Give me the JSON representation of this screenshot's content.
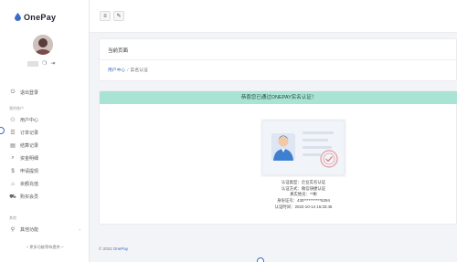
{
  "app": {
    "logo_text": "OnePay"
  },
  "sidebar": {
    "section1": "我的",
    "items": [
      {
        "label": "退出登录",
        "icon": "logout-icon",
        "glyph": "⏻"
      },
      {
        "label": "用户中心",
        "icon": "user-icon",
        "glyph": "⚇"
      },
      {
        "label": "订单记录",
        "icon": "list-icon",
        "glyph": "☰"
      },
      {
        "label": "结算记录",
        "icon": "record-icon",
        "glyph": "▤"
      },
      {
        "label": "资金明细",
        "icon": "search-money-icon",
        "glyph": "⌕"
      },
      {
        "label": "申请提现",
        "icon": "dollar-icon",
        "glyph": "$"
      },
      {
        "label": "余额充值",
        "icon": "bank-icon",
        "glyph": "⌂"
      },
      {
        "label": "购买会员",
        "icon": "cart-icon",
        "glyph": "⛟"
      }
    ],
    "section_label_1": "我的账户",
    "section_label_2": "其他",
    "other_item": {
      "label": "其他功能",
      "icon": "link-icon",
      "glyph": "⚲"
    },
    "more_note": "~ 更多功能等待提供 ~"
  },
  "topbar": {
    "menu_icon": "≡",
    "brush_icon": "✎"
  },
  "breadcrumb": {
    "title": "当前页面",
    "parent": "用户中心",
    "separator": "/",
    "current": "实名认证"
  },
  "verify": {
    "banner": "恭喜您已通过ONEPAY实名认证！",
    "lines": [
      "认证类型：企业实名认证",
      "认证方式：微信快捷认证",
      "真实姓名：**彬",
      "身份证号：430***********8294",
      "认证时间：2022-10-14 16:33:45"
    ]
  },
  "footer": {
    "copyright": "© 2022",
    "brand": "OnePay"
  },
  "colors": {
    "accent": "#3a6cc8",
    "banner_bg": "#a8e3d3"
  }
}
